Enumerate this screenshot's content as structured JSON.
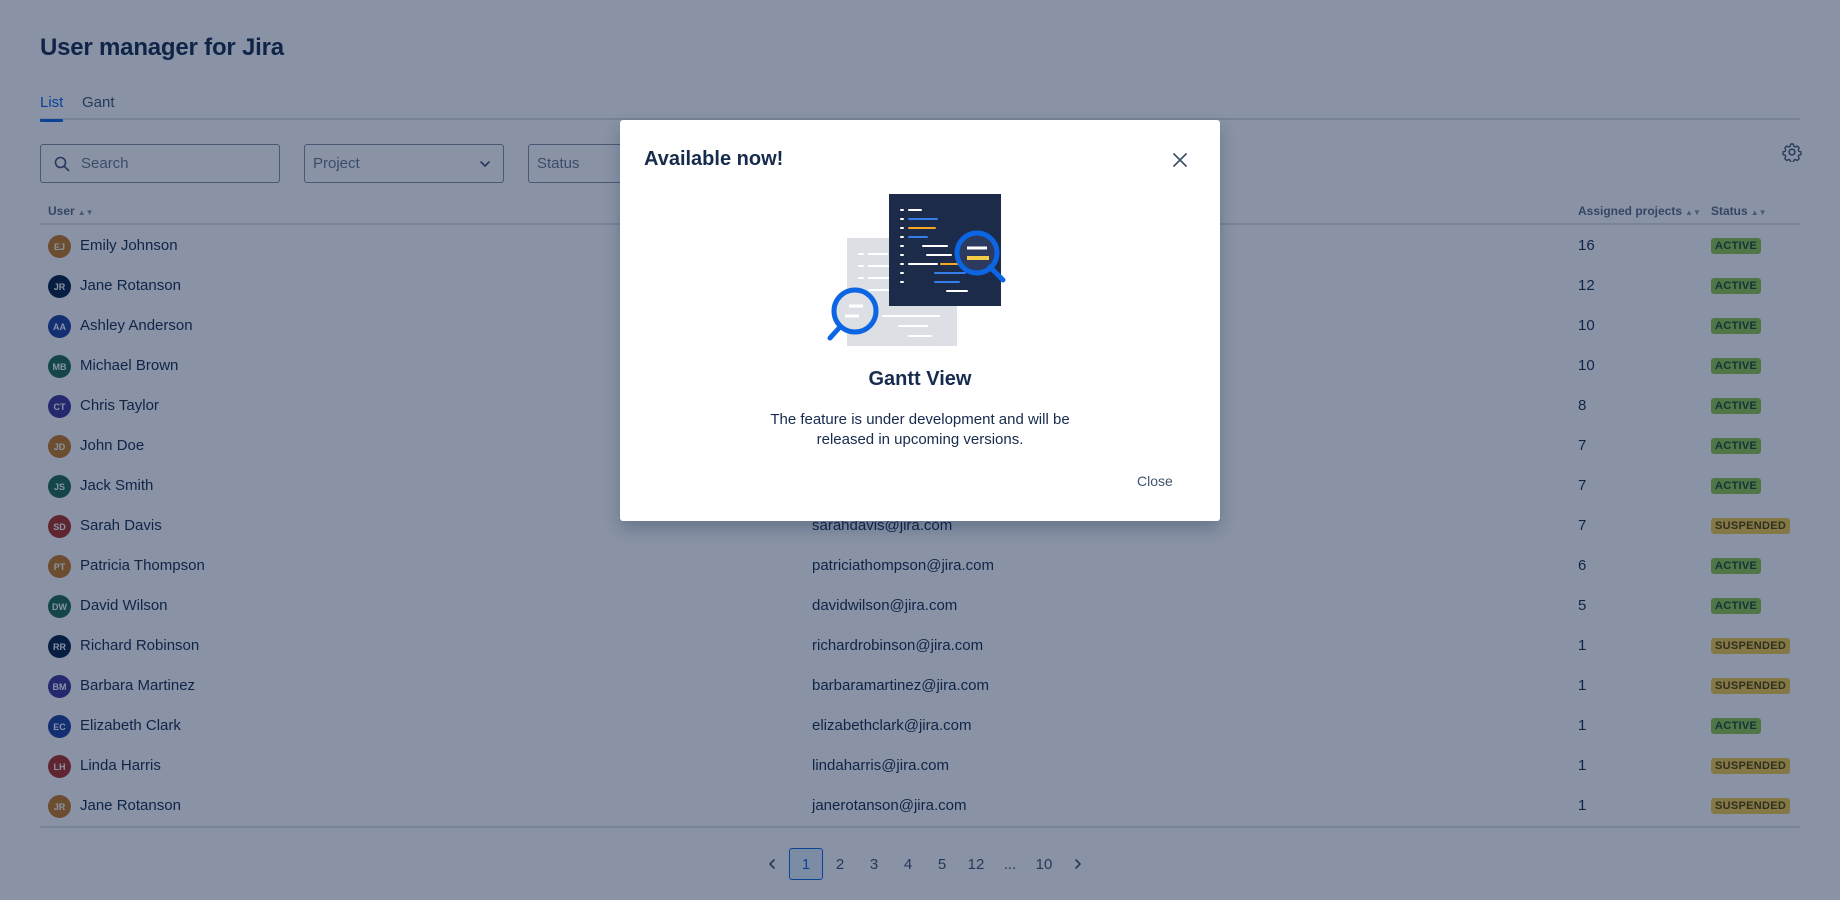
{
  "page": {
    "title": "User manager for Jira"
  },
  "tabs": [
    {
      "label": "List",
      "active": true
    },
    {
      "label": "Gant",
      "active": false
    }
  ],
  "filters": {
    "search_placeholder": "Search",
    "project_placeholder": "Project",
    "status_placeholder": "Status"
  },
  "table": {
    "columns": {
      "user": "User",
      "assigned_projects": "Assigned projects",
      "status": "Status"
    },
    "rows": [
      {
        "initials": "EJ",
        "name": "Emily Johnson",
        "email": "",
        "projects": "16",
        "status": "ACTIVE",
        "avatar_color": "#c9791f"
      },
      {
        "initials": "JR",
        "name": "Jane Rotanson",
        "email": "",
        "projects": "12",
        "status": "ACTIVE",
        "avatar_color": "#091e42"
      },
      {
        "initials": "AA",
        "name": "Ashley Anderson",
        "email": "",
        "projects": "10",
        "status": "ACTIVE",
        "avatar_color": "#1d3e9b"
      },
      {
        "initials": "MB",
        "name": "Michael Brown",
        "email": "",
        "projects": "10",
        "status": "ACTIVE",
        "avatar_color": "#1f6b4f"
      },
      {
        "initials": "CT",
        "name": "Chris Taylor",
        "email": "",
        "projects": "8",
        "status": "ACTIVE",
        "avatar_color": "#403294"
      },
      {
        "initials": "JD",
        "name": "John Doe",
        "email": "",
        "projects": "7",
        "status": "ACTIVE",
        "avatar_color": "#c9791f"
      },
      {
        "initials": "JS",
        "name": "Jack Smith",
        "email": "",
        "projects": "7",
        "status": "ACTIVE",
        "avatar_color": "#1f6b4f"
      },
      {
        "initials": "SD",
        "name": "Sarah Davis",
        "email": "sarahdavis@jira.com",
        "projects": "7",
        "status": "SUSPENDED",
        "avatar_color": "#ae2e24"
      },
      {
        "initials": "PT",
        "name": "Patricia Thompson",
        "email": "patriciathompson@jira.com",
        "projects": "6",
        "status": "ACTIVE",
        "avatar_color": "#c9791f"
      },
      {
        "initials": "DW",
        "name": "David Wilson",
        "email": "davidwilson@jira.com",
        "projects": "5",
        "status": "ACTIVE",
        "avatar_color": "#1f6b4f"
      },
      {
        "initials": "RR",
        "name": "Richard Robinson",
        "email": "richardrobinson@jira.com",
        "projects": "1",
        "status": "SUSPENDED",
        "avatar_color": "#091e42"
      },
      {
        "initials": "BM",
        "name": "Barbara Martinez",
        "email": "barbaramartinez@jira.com",
        "projects": "1",
        "status": "SUSPENDED",
        "avatar_color": "#403294"
      },
      {
        "initials": "EC",
        "name": "Elizabeth Clark",
        "email": "elizabethclark@jira.com",
        "projects": "1",
        "status": "ACTIVE",
        "avatar_color": "#1d3e9b"
      },
      {
        "initials": "LH",
        "name": "Linda Harris",
        "email": "lindaharris@jira.com",
        "projects": "1",
        "status": "SUSPENDED",
        "avatar_color": "#ae2e24"
      },
      {
        "initials": "JR",
        "name": "Jane Rotanson",
        "email": "janerotanson@jira.com",
        "projects": "1",
        "status": "SUSPENDED",
        "avatar_color": "#c9791f"
      }
    ]
  },
  "pagination": {
    "pages": [
      "1",
      "2",
      "3",
      "4",
      "5",
      "12",
      "...",
      "10"
    ],
    "current": "1"
  },
  "modal": {
    "title": "Available now!",
    "heading": "Gantt View",
    "description": "The feature is under development and will be released in upcoming versions.",
    "close_label": "Close"
  },
  "colors": {
    "accent": "#0c66e4",
    "active_badge": "#94c748",
    "suspended_badge": "#f5cd47",
    "overlay": "rgba(9,30,66,0.48)"
  }
}
